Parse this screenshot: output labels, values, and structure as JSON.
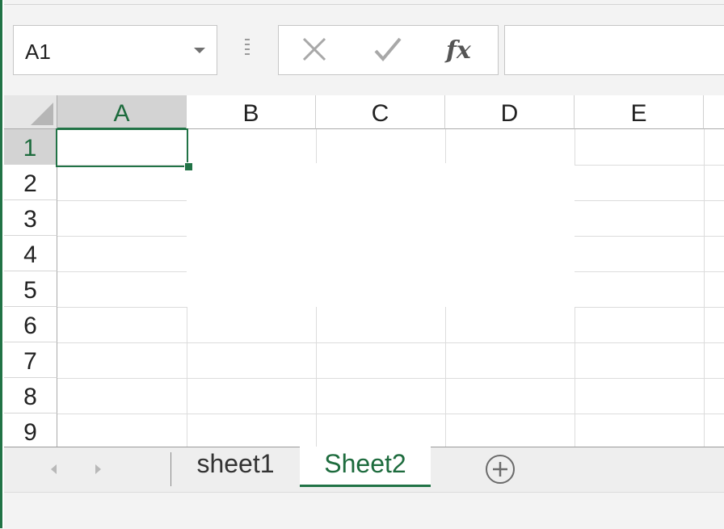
{
  "name_box": {
    "value": "A1"
  },
  "formula_bar": {
    "cancel_icon": "x-icon",
    "enter_icon": "check-icon",
    "function_label": "fx",
    "value": ""
  },
  "columns": [
    "A",
    "B",
    "C",
    "D",
    "E"
  ],
  "rows": [
    "1",
    "2",
    "3",
    "4",
    "5",
    "6",
    "7",
    "8",
    "9"
  ],
  "selection": {
    "column": "A",
    "row": "1"
  },
  "sheet_tabs": {
    "tabs": [
      "sheet1",
      "Sheet2"
    ],
    "active": "Sheet2"
  },
  "colors": {
    "accent": "#217346",
    "active_text": "#1d6b3d"
  }
}
